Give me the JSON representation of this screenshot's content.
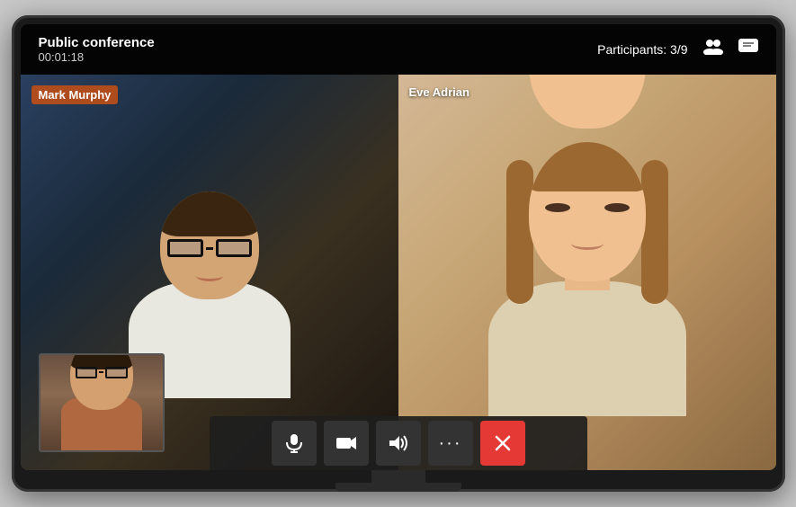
{
  "header": {
    "conference_title": "Public conference",
    "timer": "00:01:18",
    "participants_label": "Participants: 3/9"
  },
  "participants": [
    {
      "name": "Mark Murphy",
      "position": "left"
    },
    {
      "name": "Eve Adrian",
      "position": "right"
    }
  ],
  "controls": {
    "mic_label": "microphone",
    "camera_label": "camera",
    "volume_label": "volume",
    "more_label": "more options",
    "end_label": "end call"
  },
  "icons": {
    "people": "👥",
    "chat": "🗨",
    "mic": "🎤",
    "camera": "📷",
    "volume": "🔊",
    "more": "•••",
    "end_call": "✕"
  }
}
